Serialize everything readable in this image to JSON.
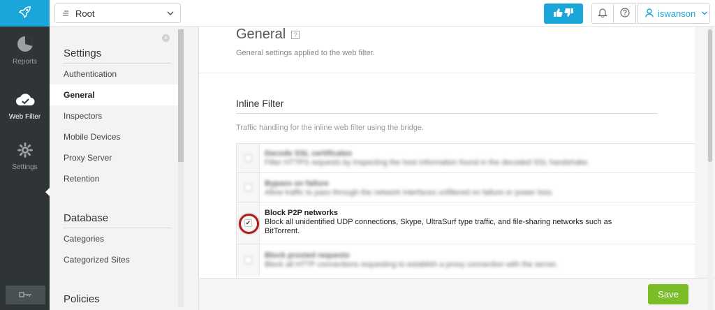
{
  "colors": {
    "accent": "#1aa6d8",
    "rail": "#2f3436",
    "save": "#7bbd26",
    "highlight": "#b21c1c"
  },
  "rail": {
    "logo_icon": "rocket-icon",
    "items": [
      {
        "label": "Reports",
        "icon": "pie-chart-icon"
      },
      {
        "label": "Web Filter",
        "icon": "cloud-check-icon"
      },
      {
        "label": "Settings",
        "icon": "gear-icon"
      }
    ],
    "bottom_icon": "key-icon"
  },
  "topbar": {
    "root_select_value": "Root",
    "feedback_icon": "thumbs-up-down-icon",
    "notifications_icon": "bell-icon",
    "help_icon": "question-circle-icon",
    "user_icon": "user-icon",
    "username": "iswanson"
  },
  "nav": {
    "sections": [
      {
        "title": "Settings",
        "items": [
          "Authentication",
          "General",
          "Inspectors",
          "Mobile Devices",
          "Proxy Server",
          "Retention"
        ]
      },
      {
        "title": "Database",
        "items": [
          "Categories",
          "Categorized Sites"
        ]
      },
      {
        "title": "Policies",
        "items": []
      }
    ],
    "active_item": "General"
  },
  "main": {
    "title": "General",
    "subtitle": "General settings applied to the web filter.",
    "section_title": "Inline Filter",
    "section_subtitle": "Traffic handling for the inline web filter using the bridge.",
    "options": [
      {
        "title": "Decode SSL certificates",
        "desc": "Filter HTTPS requests by inspecting the host information found in the decoded SSL handshake.",
        "checked": false,
        "obscured": true
      },
      {
        "title": "Bypass on failure",
        "desc": "Allow traffic to pass through the network interfaces unfiltered on failure or power loss.",
        "checked": false,
        "obscured": true
      },
      {
        "title": "Block P2P networks",
        "desc": "Block all unidentified UDP connections, Skype, UltraSurf type traffic, and file-sharing networks such as BitTorrent.",
        "checked": true,
        "obscured": false
      },
      {
        "title": "Block proxied requests",
        "desc": "Block all HTTP connections requesting to establish a proxy connection with the server.",
        "checked": false,
        "obscured": true
      }
    ],
    "save_label": "Save"
  }
}
